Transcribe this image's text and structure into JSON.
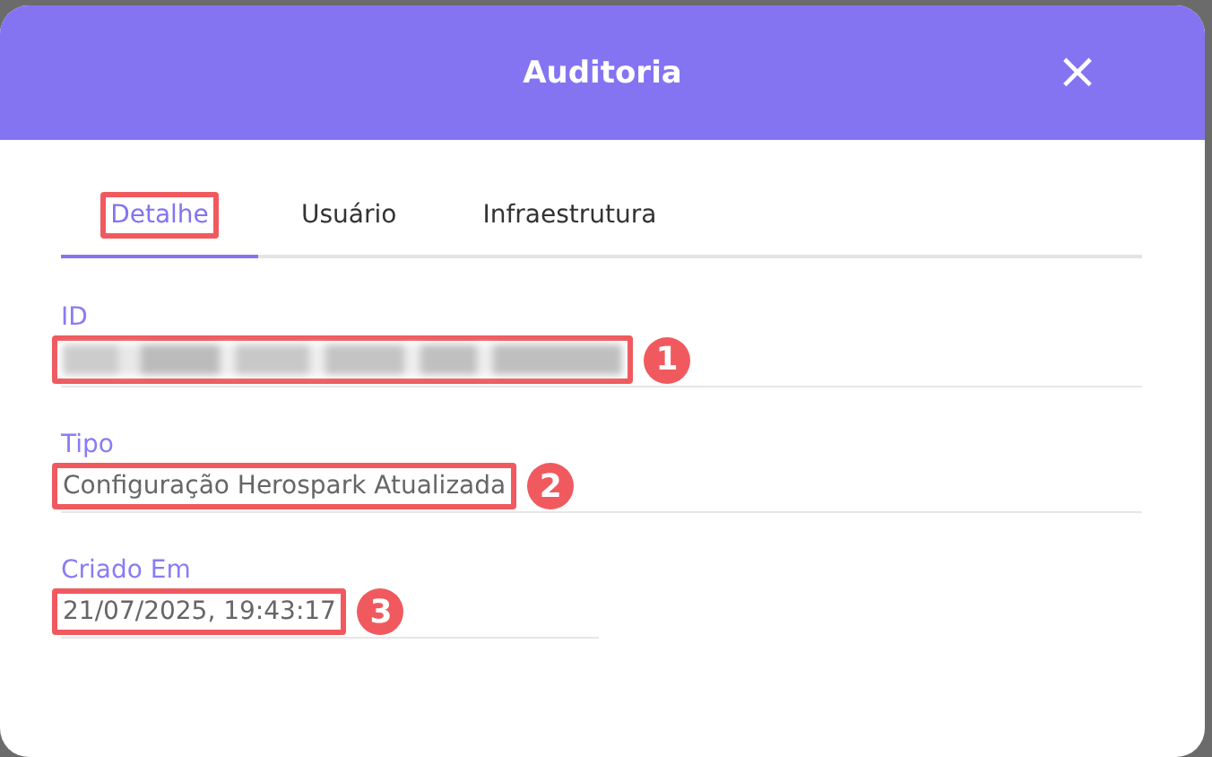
{
  "dialog": {
    "title": "Auditoria",
    "close_icon": "×"
  },
  "tabs": [
    {
      "label": "Detalhe",
      "selected": true,
      "highlighted": true
    },
    {
      "label": "Usuário",
      "selected": false,
      "highlighted": false
    },
    {
      "label": "Infraestrutura",
      "selected": false,
      "highlighted": false
    }
  ],
  "fields": [
    {
      "label": "ID",
      "kind": "redacted",
      "highlighted": true,
      "marker": "1"
    },
    {
      "label": "Tipo",
      "kind": "text",
      "value": "Configuração Herospark Atualizada",
      "highlighted": true,
      "marker": "2"
    },
    {
      "label": "Criado Em",
      "kind": "text",
      "value": "21/07/2025, 19:43:17",
      "highlighted": true,
      "marker": "3"
    }
  ]
}
